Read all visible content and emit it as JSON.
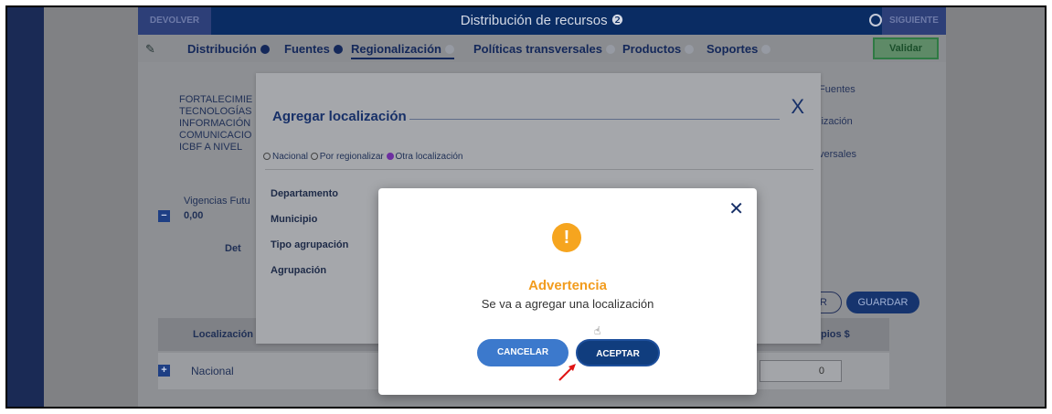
{
  "topbar": {
    "back_label": "DEVOLVER",
    "title": "Distribución de recursos ❷",
    "next_label": "SIGUIENTE"
  },
  "tabs": [
    {
      "label": "Distribución",
      "filled": true
    },
    {
      "label": "Fuentes",
      "filled": true
    },
    {
      "label": "Regionalización",
      "filled": false
    },
    {
      "label": "Políticas transversales",
      "filled": false
    },
    {
      "label": "Productos",
      "filled": false
    },
    {
      "label": "Soportes",
      "filled": false
    }
  ],
  "validate_label": "Validar",
  "background": {
    "project_text": [
      "FORTALECIMIE",
      "TECNOLOGÍAS",
      "INFORMACIÓN",
      "COMUNICACIO",
      "ICBF A NIVEL"
    ],
    "vigencias_label": "Vigencias Futu",
    "vigencias_value": "0,00",
    "detail_label": "Det",
    "right_labels": [
      "Fuentes",
      "lización",
      "versales"
    ],
    "partial_button": "R",
    "save_label": "GUARDAR",
    "col_localizacion": "Localización",
    "col_right": "pios $",
    "row_label": "Nacional",
    "row_value": "0"
  },
  "location_modal": {
    "title": "Agregar localización",
    "close_glyph": "X",
    "radio_options": [
      {
        "label": "Nacional",
        "checked": false
      },
      {
        "label": "Por regionalizar",
        "checked": false
      },
      {
        "label": "Otra localización",
        "checked": true
      }
    ],
    "fields": [
      "Departamento",
      "Municipio",
      "Tipo agrupación",
      "Agrupación"
    ]
  },
  "dialog": {
    "close_glyph": "✕",
    "warning_glyph": "!",
    "title": "Advertencia",
    "message": "Se va a agregar una localización",
    "cancel_label": "CANCELAR",
    "accept_label": "ACEPTAR"
  },
  "colors": {
    "accent": "#103d7e",
    "warning": "#f6a51f"
  }
}
